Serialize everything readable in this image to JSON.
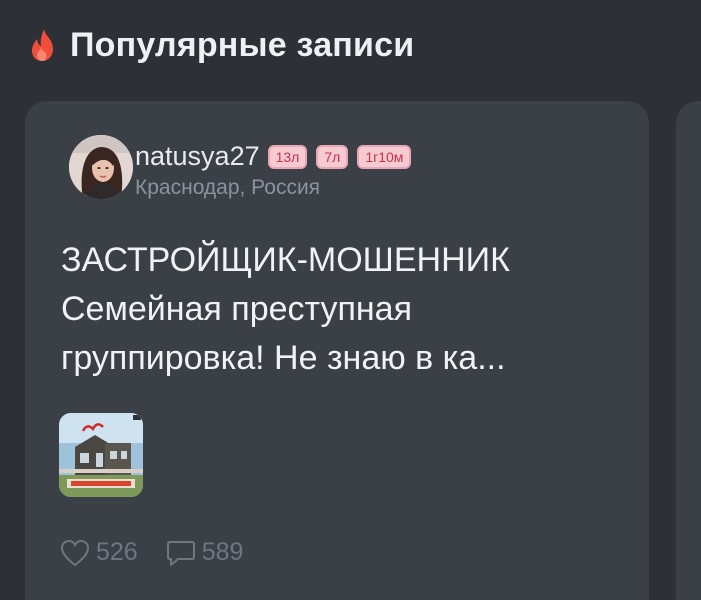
{
  "header": {
    "icon": "fire-icon",
    "title": "Популярные записи"
  },
  "post": {
    "author": {
      "username": "natusya27",
      "badges": [
        "13л",
        "7л",
        "1г10м"
      ],
      "location": "Краснодар, Россия",
      "avatar_icon": "avatar-photo"
    },
    "text_lines": [
      "ЗАСТРОЙЩИК-МОШЕННИК",
      "Семейная преступная",
      "группировка!  Не знаю в ка..."
    ],
    "thumbnail_icon": "house-photo",
    "stats": {
      "likes": "526",
      "comments": "589"
    }
  },
  "colors": {
    "background": "#2d3036",
    "card": "#3b3f46",
    "accent_fire": "#f04e3a",
    "badge_bg": "#f7c9d0",
    "badge_text": "#c0354f"
  }
}
